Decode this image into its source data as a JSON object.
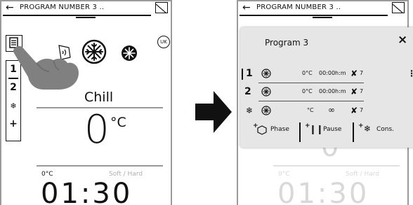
{
  "left_screen": {
    "title": "PROGRAM NUMBER 3 ..",
    "steps": [
      "1",
      "2",
      "+"
    ],
    "region_badge": "UK",
    "mode": "Chill",
    "temperature": "0",
    "temperature_unit": "°C",
    "probe_temp": "0°C",
    "soft_hard": "Soft / Hard",
    "time": "01:30"
  },
  "right_screen": {
    "title": "PROGRAM NUMBER 3 ..",
    "faded_temp": "0",
    "faded_probe": "0°C",
    "faded_soft_hard": "Soft / Hard",
    "faded_time": "01:30",
    "popup": {
      "title": "Program 3",
      "close": "×",
      "rows": [
        {
          "num": "1",
          "temp": "0°C",
          "time": "00:00h:m",
          "fan": "7"
        },
        {
          "num": "2",
          "temp": "0°C",
          "time": "00:00h:m",
          "fan": "7"
        },
        {
          "num": "",
          "temp": "°C",
          "time": "",
          "fan": "7"
        }
      ],
      "actions": {
        "phase": "Phase",
        "pause": "Pause",
        "cons": "Cons."
      }
    }
  },
  "icons": {
    "back": "arrow-left-icon",
    "corner": "window-corner-icon",
    "menu": "document-icon",
    "sound": "sound-icon",
    "snowflake": "snowflake-icon"
  }
}
